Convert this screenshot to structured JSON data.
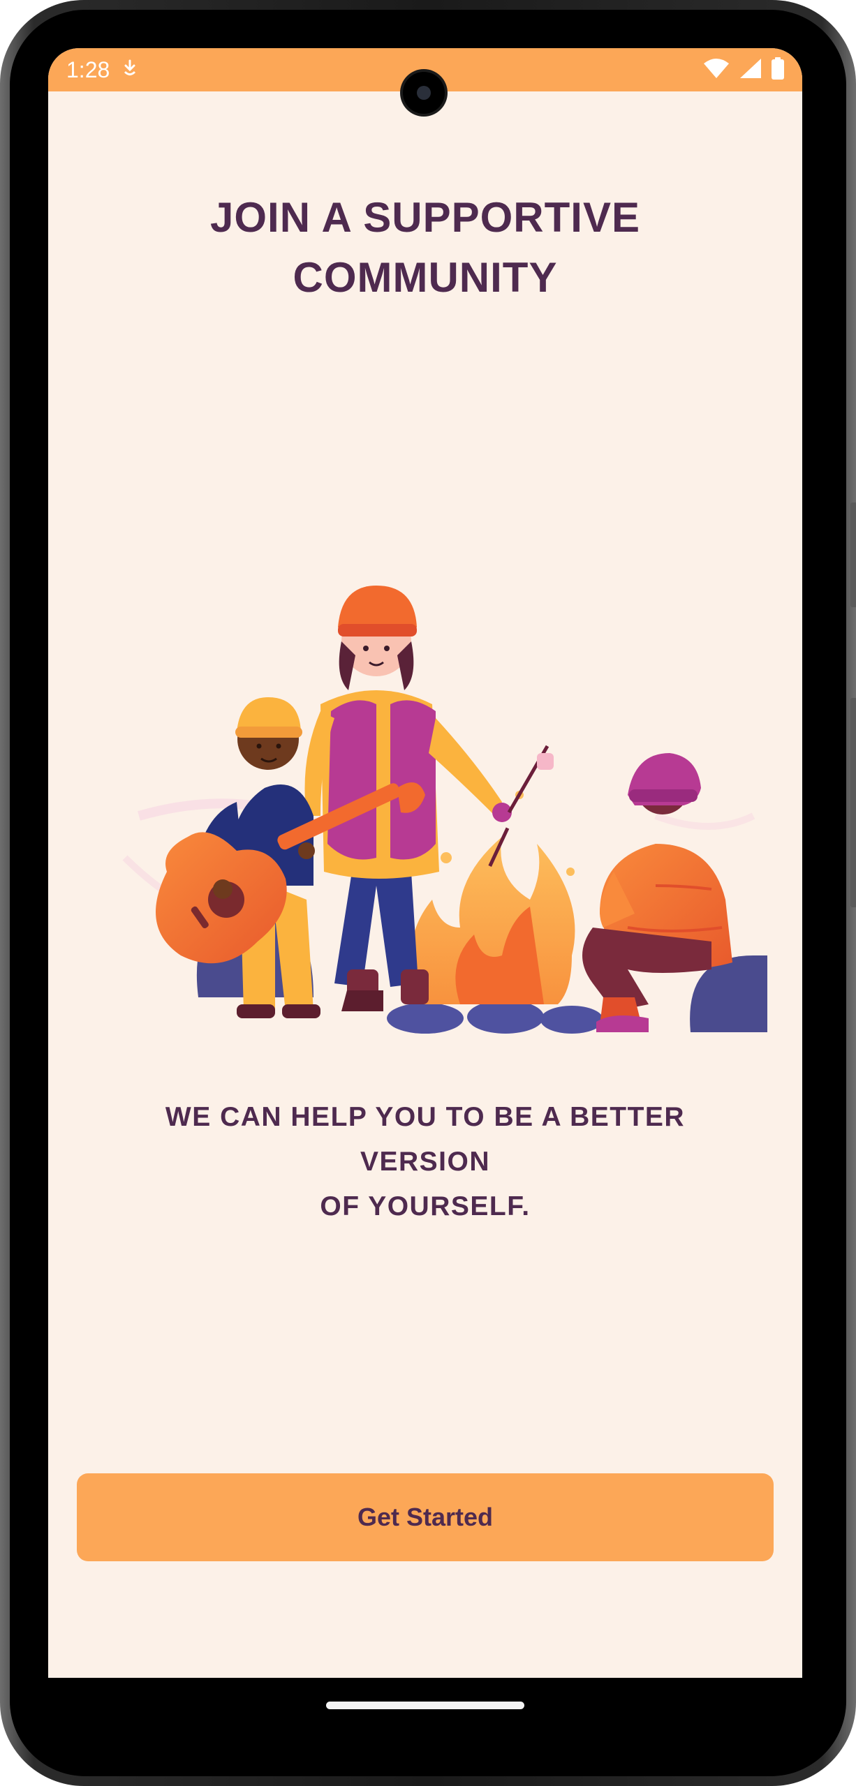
{
  "status_bar": {
    "time": "1:28",
    "background": "#FCA757"
  },
  "screen": {
    "title_line1": "JOIN A SUPPORTIVE",
    "title_line2": "COMMUNITY",
    "subtitle_line1": "WE CAN HELP YOU TO BE A BETTER VERSION",
    "subtitle_line2": "OF YOURSELF.",
    "cta_label": "Get Started",
    "background": "#FCF1E8",
    "text_color": "#4E2A4F",
    "accent": "#FCA757"
  },
  "illustration": {
    "icon": "campfire-community-illustration"
  },
  "icons": [
    "download-icon",
    "wifi-icon",
    "signal-icon",
    "battery-icon"
  ]
}
